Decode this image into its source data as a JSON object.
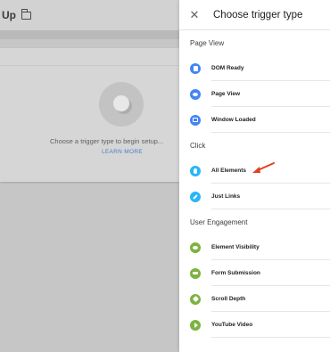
{
  "background": {
    "title": "Up",
    "empty_message": "Choose a trigger type to begin setup...",
    "learn_more": "LEARN MORE"
  },
  "panel": {
    "close_icon": "close-icon",
    "title": "Choose trigger type",
    "sections": [
      {
        "title": "Page View",
        "items": [
          {
            "label": "DOM Ready",
            "icon": "dom-ready-icon",
            "color": "#4285f4"
          },
          {
            "label": "Page View",
            "icon": "eye-icon",
            "color": "#4285f4"
          },
          {
            "label": "Window Loaded",
            "icon": "window-icon",
            "color": "#4285f4"
          }
        ]
      },
      {
        "title": "Click",
        "items": [
          {
            "label": "All Elements",
            "icon": "mouse-icon",
            "color": "#29b6f6"
          },
          {
            "label": "Just Links",
            "icon": "link-icon",
            "color": "#29b6f6"
          }
        ]
      },
      {
        "title": "User Engagement",
        "items": [
          {
            "label": "Element Visibility",
            "icon": "eye-icon",
            "color": "#7cb342"
          },
          {
            "label": "Form Submission",
            "icon": "form-icon",
            "color": "#7cb342"
          },
          {
            "label": "Scroll Depth",
            "icon": "scroll-icon",
            "color": "#7cb342"
          },
          {
            "label": "YouTube Video",
            "icon": "play-icon",
            "color": "#7cb342"
          }
        ]
      }
    ]
  },
  "annotation": {
    "arrow_color": "#e0401f"
  }
}
